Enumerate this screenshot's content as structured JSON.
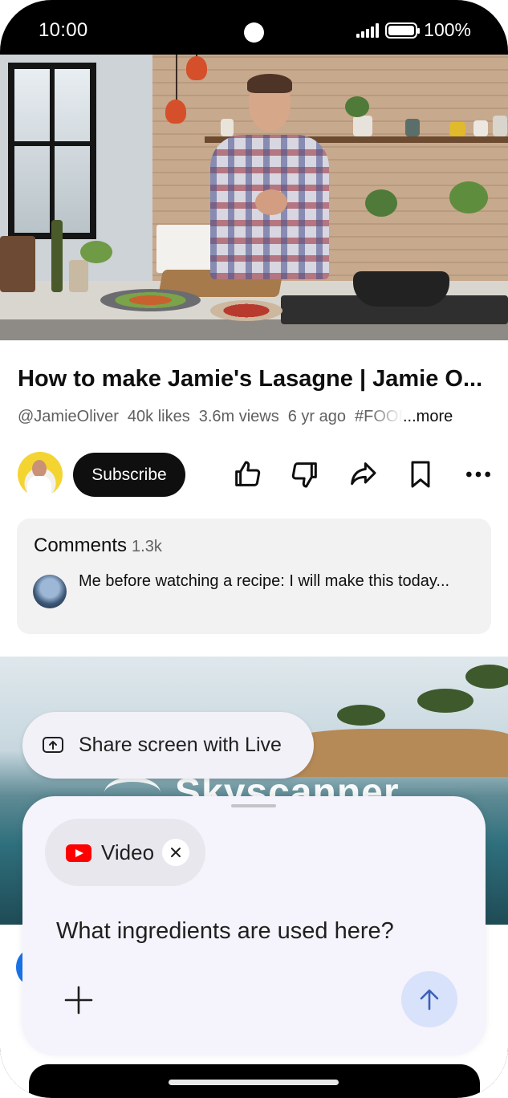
{
  "status_bar": {
    "time": "10:00",
    "battery": "100%"
  },
  "video": {
    "title": "How to make Jamie's Lasagne | Jamie O...",
    "channel": "@JamieOliver",
    "likes": "40k likes",
    "views": "3.6m views",
    "age": "6 yr ago",
    "hashtag": "#FOOD",
    "more": "...more"
  },
  "actions": {
    "subscribe_label": "Subscribe",
    "like_icon": "thumbs-up-icon",
    "dislike_icon": "thumbs-down-icon",
    "share_icon": "share-icon",
    "save_icon": "bookmark-icon",
    "more_icon": "more-horizontal-icon"
  },
  "comments": {
    "title": "Comments",
    "count": "1.3k",
    "top_comment": "Me before watching a recipe: I will make this today..."
  },
  "ad": {
    "brand": "Skyscanner"
  },
  "live": {
    "share_label": "Share screen with Live"
  },
  "assistant": {
    "attachment_label": "Video",
    "prompt_text": "What ingredients are used here?"
  },
  "colors": {
    "accent_send": "#d9e2fb",
    "youtube_red": "#ff0000",
    "subscribe_bg": "#0f0f0f",
    "sheet_bg": "#f5f3fb"
  }
}
